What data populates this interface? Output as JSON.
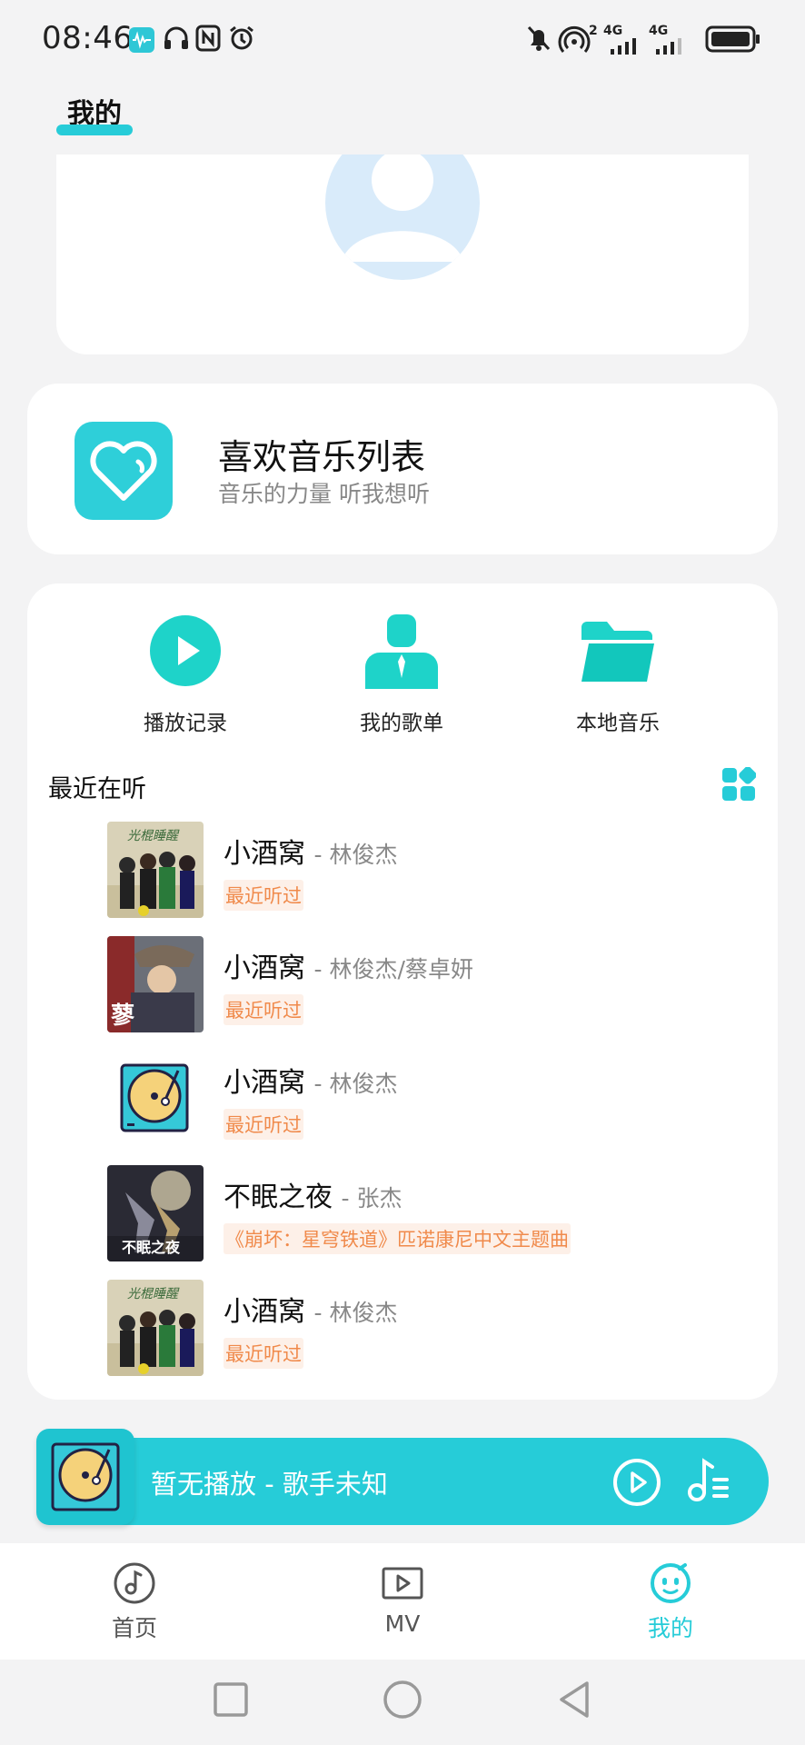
{
  "status_bar": {
    "time": "08:46",
    "signal_1_label": "2",
    "signal_2_label": "4G",
    "signal_3_label": "4G"
  },
  "header": {
    "title": "我的"
  },
  "favorites": {
    "title": "喜欢音乐列表",
    "subtitle": "音乐的力量 听我想听"
  },
  "quick_actions": [
    {
      "label": "播放记录",
      "icon": "play-circle-icon"
    },
    {
      "label": "我的歌单",
      "icon": "user-playlist-icon"
    },
    {
      "label": "本地音乐",
      "icon": "folder-icon"
    }
  ],
  "recent": {
    "title": "最近在听",
    "songs": [
      {
        "name": "小酒窝",
        "artist": "- 林俊杰",
        "tag": "最近听过",
        "cover": "album-cover-1"
      },
      {
        "name": "小酒窝",
        "artist": "- 林俊杰/蔡卓妍",
        "tag": "最近听过",
        "cover": "album-cover-2"
      },
      {
        "name": "小酒窝",
        "artist": "- 林俊杰",
        "tag": "最近听过",
        "cover": "turntable-icon"
      },
      {
        "name": "不眠之夜",
        "artist": "- 张杰",
        "tag": "《崩坏：星穹铁道》匹诺康尼中文主题曲",
        "cover": "album-cover-3"
      },
      {
        "name": "小酒窝",
        "artist": "- 林俊杰",
        "tag": "最近听过",
        "cover": "album-cover-1"
      }
    ]
  },
  "player": {
    "text": "暂无播放 - 歌手未知"
  },
  "bottom_nav": [
    {
      "label": "首页",
      "icon": "music-note-icon",
      "active": false
    },
    {
      "label": "MV",
      "icon": "video-icon",
      "active": false
    },
    {
      "label": "我的",
      "icon": "smile-icon",
      "active": true
    }
  ],
  "colors": {
    "accent": "#26ccd8",
    "tag_text": "#f08a4b",
    "tag_bg": "#fdf0e8",
    "background": "#f3f3f4"
  }
}
